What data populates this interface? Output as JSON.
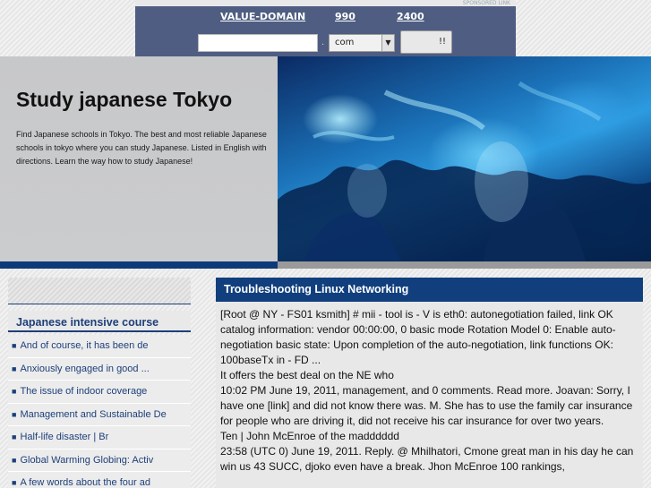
{
  "ad": {
    "sponsored_label": "SPONSORED LINK",
    "domain_label": "VALUE-DOMAIN",
    "price1": "990",
    "price2": "2400",
    "domain_input_value": "",
    "dot": ".",
    "tld_selected": "com",
    "go_label": "!!"
  },
  "hero": {
    "title": "Study japanese Tokyo",
    "description": "Find Japanese schools in Tokyo. The best and most reliable Japanese schools in tokyo where you can study Japanese. Listed in English with directions. Learn the way how to study Japanese!"
  },
  "sidebar": {
    "heading": "Japanese intensive course",
    "bullet": "■",
    "items": [
      {
        "label": "And of course, it has been de"
      },
      {
        "label": "Anxiously engaged in good ..."
      },
      {
        "label": "The issue of indoor coverage"
      },
      {
        "label": "Management and Sustainable De"
      },
      {
        "label": "Half-life disaster | Br"
      },
      {
        "label": "Global Warming Globing: Activ"
      },
      {
        "label": "A few words about the four ad"
      }
    ]
  },
  "main": {
    "heading": "Troubleshooting Linux Networking",
    "paragraphs": [
      "[Root @ NY - FS01 ksmith] # mii - tool is - V is eth0: autonegotiation failed, link OK catalog information: vendor 00:00:00, 0 basic mode Rotation Model 0: Enable auto-negotiation basic state: Upon completion of the auto-negotiation, link functions OK: 100baseTx in - FD ...",
      "It offers the best deal on the NE who",
      "10:02 PM June 19, 2011, management, and 0 comments. Read more. Joavan: Sorry, I have one [link] and did not know there was. M. She has to use the family car insurance for people who are driving it, did not receive his car insurance for over two years.",
      "Ten | John McEnroe of the madddddd",
      "23:58 (UTC 0) June 19, 2011. Reply. @ Mhilhatori, Cmone great man in his day he can win us 43 SUCC, djoko even have a break. Jhon McEnroe 100 rankings,"
    ]
  },
  "colors": {
    "navy": "#113f7e",
    "ad_bg": "#4e5d81",
    "panel_grey": "#e8e8e8"
  }
}
